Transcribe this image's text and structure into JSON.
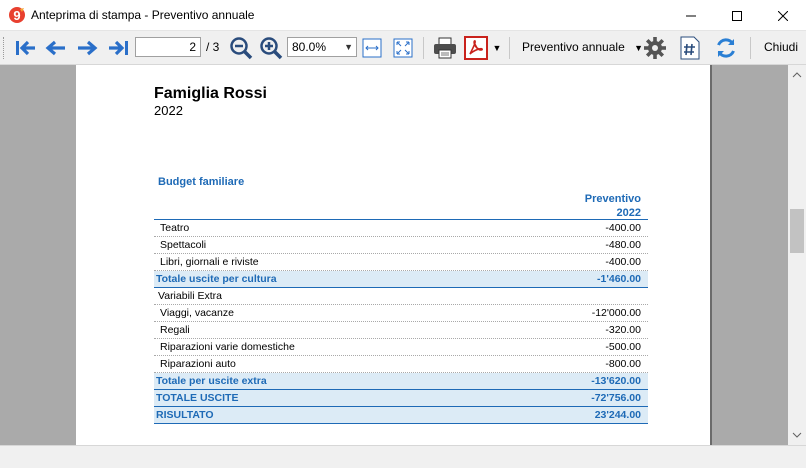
{
  "window": {
    "title": "Anteprima di stampa - Preventivo annuale",
    "colors": {
      "accent": "#1e6ab6",
      "total_row_bg": "#dcebf6",
      "viewer_bg": "#aaaaaa"
    }
  },
  "toolbar": {
    "page_current": "2",
    "page_total": "/ 3",
    "zoom": "80.0%",
    "report": "Preventivo annuale",
    "close_label": "Chiudi"
  },
  "report": {
    "family": "Famiglia Rossi",
    "year": "2022",
    "section_title": "Budget familiare",
    "column_header": [
      "Preventivo",
      "2022"
    ],
    "rows": [
      {
        "label": "Teatro",
        "value": "-400.00",
        "kind": "item"
      },
      {
        "label": "Spettacoli",
        "value": "-480.00",
        "kind": "item"
      },
      {
        "label": "Libri, giornali e riviste",
        "value": "-400.00",
        "kind": "item"
      },
      {
        "label": "Totale uscite per cultura",
        "value": "-1'460.00",
        "kind": "total"
      },
      {
        "label": "Variabili Extra",
        "value": "",
        "kind": "group"
      },
      {
        "label": "Viaggi, vacanze",
        "value": "-12'000.00",
        "kind": "item"
      },
      {
        "label": "Regali",
        "value": "-320.00",
        "kind": "item"
      },
      {
        "label": "Riparazioni varie domestiche",
        "value": "-500.00",
        "kind": "item"
      },
      {
        "label": "Riparazioni auto",
        "value": "-800.00",
        "kind": "item"
      },
      {
        "label": "Totale per uscite extra",
        "value": "-13'620.00",
        "kind": "total"
      },
      {
        "label": "TOTALE USCITE",
        "value": "-72'756.00",
        "kind": "total"
      },
      {
        "label": "RISULTATO",
        "value": "23'244.00",
        "kind": "total"
      }
    ]
  }
}
